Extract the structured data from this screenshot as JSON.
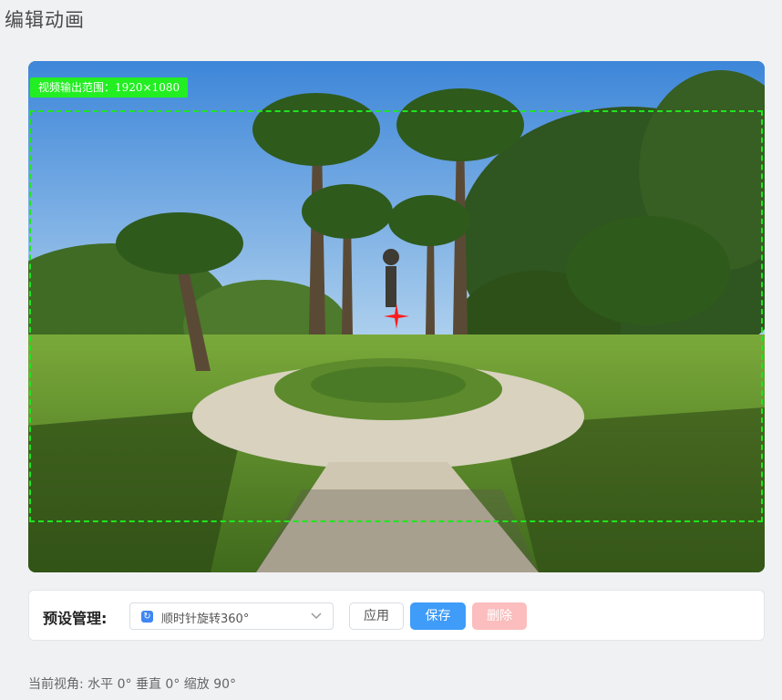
{
  "page": {
    "title": "编辑动画"
  },
  "viewer": {
    "output_label": "视频输出范围：1920×1080"
  },
  "preset": {
    "label": "预设管理:",
    "selected": "顺时针旋转360°",
    "apply_label": "应用",
    "save_label": "保存",
    "delete_label": "删除"
  },
  "status": {
    "view_text": "当前视角: 水平 0° 垂直 0° 缩放 90°"
  },
  "colors": {
    "output_frame": "#1fe61f",
    "crosshair": "#ff1a1a",
    "save_button": "#3f9cf8",
    "delete_button": "#fbbdbd"
  }
}
